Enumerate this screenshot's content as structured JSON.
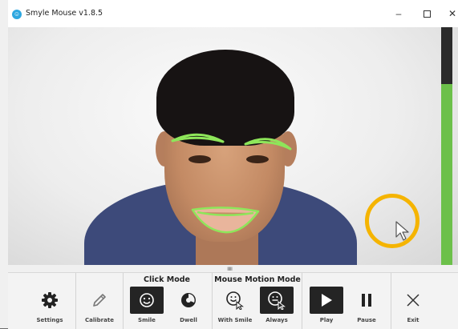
{
  "window": {
    "title": "Smyle Mouse v1.8.5",
    "app_icon": "smile-icon",
    "controls": [
      "minimize-icon",
      "maximize-icon",
      "close-icon"
    ],
    "minimize_glyph": "–",
    "close_glyph": "✕"
  },
  "camera": {
    "feature_outline_color": "#8ee65a",
    "dwell_ring_color": "#f5b400",
    "meter_color": "#6cc04a",
    "meter_level": 0.76
  },
  "toolbar": {
    "handle_glyph": "ııııı",
    "settings": {
      "label": "Settings",
      "icon": "gear-icon"
    },
    "calibrate": {
      "label": "Calibrate",
      "icon": "pencil-icon"
    },
    "click_mode": {
      "title": "Click Mode",
      "smile": {
        "label": "Smile",
        "icon": "smile-icon",
        "selected": true
      },
      "dwell": {
        "label": "Dwell",
        "icon": "dwell-icon",
        "selected": false
      }
    },
    "mouse_motion_mode": {
      "title": "Mouse Motion Mode",
      "with_smile": {
        "label": "With Smile",
        "icon": "smile-cursor-icon",
        "selected": false
      },
      "always": {
        "label": "Always",
        "icon": "cursor-face-icon",
        "selected": true
      }
    },
    "play": {
      "label": "Play",
      "icon": "play-icon",
      "selected": true
    },
    "pause": {
      "label": "Pause",
      "icon": "pause-icon"
    },
    "exit": {
      "label": "Exit",
      "icon": "close-icon"
    }
  }
}
